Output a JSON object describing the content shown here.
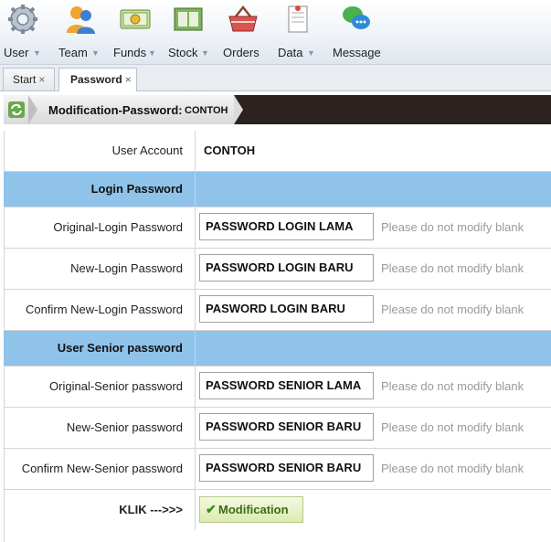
{
  "toolbar": {
    "items": [
      {
        "label": "User",
        "has_dropdown": true,
        "icon": "gear-icon"
      },
      {
        "label": "Team",
        "has_dropdown": true,
        "icon": "team-icon"
      },
      {
        "label": "Funds",
        "has_dropdown": true,
        "icon": "money-icon"
      },
      {
        "label": "Stock",
        "has_dropdown": true,
        "icon": "stock-icon"
      },
      {
        "label": "Orders",
        "has_dropdown": false,
        "icon": "basket-icon"
      },
      {
        "label": "Data",
        "has_dropdown": true,
        "icon": "document-icon"
      },
      {
        "label": "Message",
        "has_dropdown": false,
        "icon": "chat-icon"
      }
    ]
  },
  "tabs": [
    {
      "label": "Start",
      "close": "×",
      "active": false
    },
    {
      "label": "Password",
      "close": "×",
      "active": true
    }
  ],
  "header": {
    "title": "Modification-Password:",
    "username": "CONTOH"
  },
  "form": {
    "user_account": {
      "label": "User Account",
      "value": "CONTOH"
    },
    "login_section": "Login Password",
    "login_rows": [
      {
        "label": "Original-Login Password",
        "value": "PASSWORD LOGIN LAMA",
        "hint": "Please do not modify blank"
      },
      {
        "label": "New-Login Password",
        "value": "PASSWORD LOGIN BARU",
        "hint": "Please do not modify blank"
      },
      {
        "label": "Confirm New-Login Password",
        "value": "PASWORD LOGIN BARU",
        "hint": "Please do not modify blank"
      }
    ],
    "senior_section": "User Senior password",
    "senior_rows": [
      {
        "label": "Original-Senior password",
        "value": "PASSWORD SENIOR LAMA",
        "hint": "Please do not modify blank"
      },
      {
        "label": "New-Senior password",
        "value": "PASSWORD SENIOR BARU",
        "hint": "Please do not modify blank"
      },
      {
        "label": "Confirm New-Senior password",
        "value": "PASSWORD SENIOR BARU",
        "hint": "Please do not modify blank"
      }
    ],
    "action": {
      "label": "KLIK --->>>",
      "button": "Modification"
    }
  },
  "colors": {
    "section_bg": "#8fc3ea",
    "header_dark": "#2c2220",
    "button_text": "#3b6b14"
  }
}
